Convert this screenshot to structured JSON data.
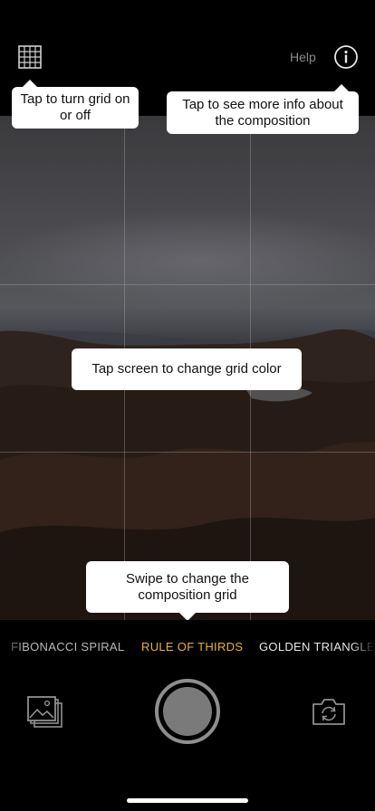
{
  "header": {
    "grid_toggle_icon": "grid-icon",
    "help_label": "Help",
    "info_icon": "info-circle-icon"
  },
  "tooltips": {
    "grid": "Tap to turn grid on or off",
    "info": "Tap to see more info about the composition",
    "color": "Tap screen to change grid color",
    "swipe": "Swipe to change the composition grid"
  },
  "modes": {
    "items": [
      "FIBONACCI SPIRAL",
      "RULE OF THIRDS",
      "GOLDEN TRIANGLE"
    ],
    "selected": "RULE OF THIRDS",
    "accent_color": "#e8b13c"
  },
  "controls": {
    "gallery_icon": "photo-gallery-icon",
    "shutter_icon": "shutter-button",
    "flip_icon": "flip-camera-icon"
  }
}
